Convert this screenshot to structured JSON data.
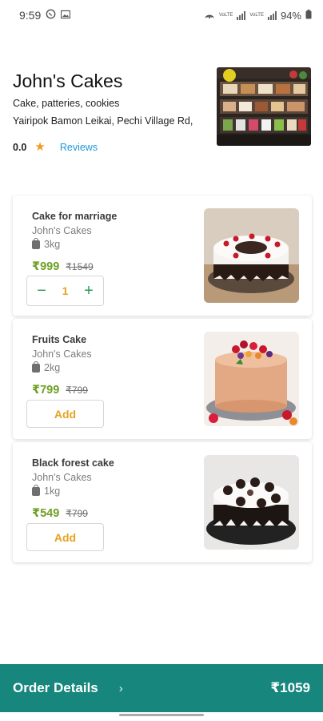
{
  "status_bar": {
    "time": "9:59",
    "network_label_1": "VoLTE",
    "network_label_2": "VoLTE",
    "battery": "94%"
  },
  "store": {
    "name": "John's Cakes",
    "tags": "Cake, patteries, cookies",
    "address": "Yairipok Bamon Leikai, Pechi Village Rd,",
    "rating": "0.0",
    "reviews_label": "Reviews"
  },
  "products": [
    {
      "name": "Cake for marriage",
      "seller": "John's Cakes",
      "weight": "3kg",
      "price": "₹999",
      "mrp": "₹1549",
      "quantity": "1",
      "action": null
    },
    {
      "name": "Fruits Cake",
      "seller": "John's Cakes",
      "weight": "2kg",
      "price": "₹799",
      "mrp": "₹799",
      "quantity": null,
      "action": "Add"
    },
    {
      "name": "Black forest cake",
      "seller": "John's Cakes",
      "weight": "1kg",
      "price": "₹549",
      "mrp": "₹799",
      "quantity": null,
      "action": "Add"
    }
  ],
  "order_bar": {
    "label": "Order Details",
    "total": "₹1059"
  },
  "colors": {
    "accent_green": "#17877d",
    "price_green": "#6e9f24",
    "add_orange": "#e6a21f",
    "star_orange": "#f29b1a",
    "link_blue": "#1e98d6"
  }
}
